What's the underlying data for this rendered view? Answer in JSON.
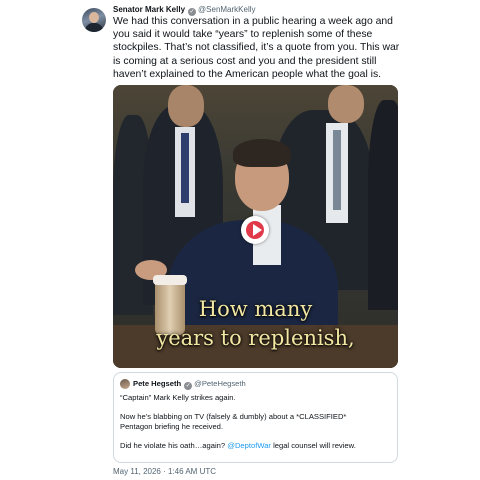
{
  "tweet": {
    "author_name": "Senator Mark Kelly",
    "author_handle": "@SenMarkKelly",
    "text": "We had this conversation in a public hearing a week ago and you said it would take “years” to replenish some of these stockpiles. That’s not classified, it’s a quote from you. This war is coming at a serious cost and you and the president still haven’t explained to the American people what the goal is.",
    "timestamp": "May 11, 2026 · 1:46 AM UTC"
  },
  "video": {
    "caption_line1": "How many",
    "caption_line2": "years to replenish,"
  },
  "quoted_tweet": {
    "author_name": "Pete Hegseth",
    "author_handle": "@PeteHegseth",
    "line1": "“Captain” Mark Kelly strikes again.",
    "line2": "Now he’s blabbing on TV (falsely & dumbly) about a *CLASSIFIED*",
    "line3": "Pentagon briefing he received.",
    "line4_before": "Did he violate his oath…again? ",
    "line4_mention": "@DeptofWar",
    "line4_after": " legal counsel will review."
  },
  "icons": {
    "verified": "verified-badge-icon",
    "play": "play-icon"
  },
  "colors": {
    "link": "#1d9bf0",
    "play_button": "#e0394a",
    "caption": "#f1e7a2"
  }
}
